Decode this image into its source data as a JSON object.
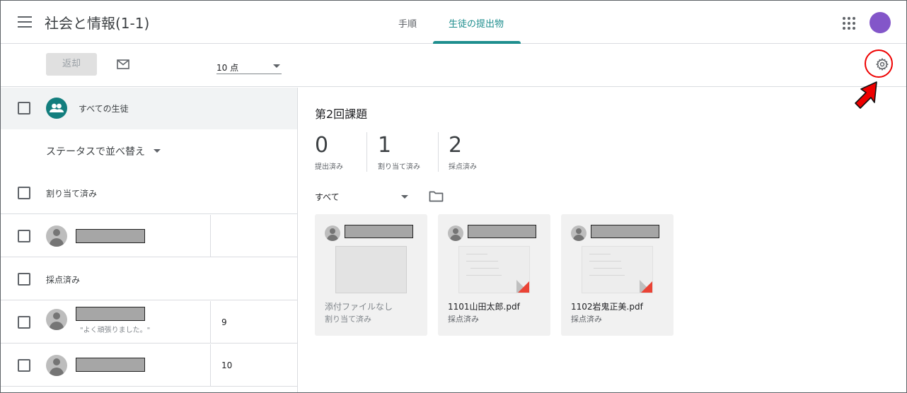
{
  "header": {
    "class_title": "社会と情報(1-1)",
    "tabs": [
      {
        "label": "手順"
      },
      {
        "label": "生徒の提出物"
      }
    ]
  },
  "toolbar": {
    "return_label": "返却",
    "points_value": "10 点"
  },
  "left_panel": {
    "all_students_label": "すべての生徒",
    "sort_label": "ステータスで並べ替え",
    "sections": [
      {
        "label": "割り当て済み"
      },
      {
        "label": "採点済み"
      }
    ],
    "students": [
      {
        "grade": "",
        "comment": ""
      },
      {
        "grade": "9",
        "comment": "\"よく頑張りました。\""
      },
      {
        "grade": "10",
        "comment": ""
      }
    ]
  },
  "main": {
    "assignment_title": "第2回課題",
    "stats": [
      {
        "value": "0",
        "label": "提出済み"
      },
      {
        "value": "1",
        "label": "割り当て済み"
      },
      {
        "value": "2",
        "label": "採点済み"
      }
    ],
    "filter_value": "すべて",
    "cards": [
      {
        "file": "添付ファイルなし",
        "status": "割り当て済み"
      },
      {
        "file": "1101山田太郎.pdf",
        "status": "採点済み"
      },
      {
        "file": "1102岩鬼正美.pdf",
        "status": "採点済み"
      }
    ]
  },
  "colors": {
    "accent": "#1e8e8e",
    "avatar": "#8356c9",
    "highlight": "#ee0000"
  }
}
